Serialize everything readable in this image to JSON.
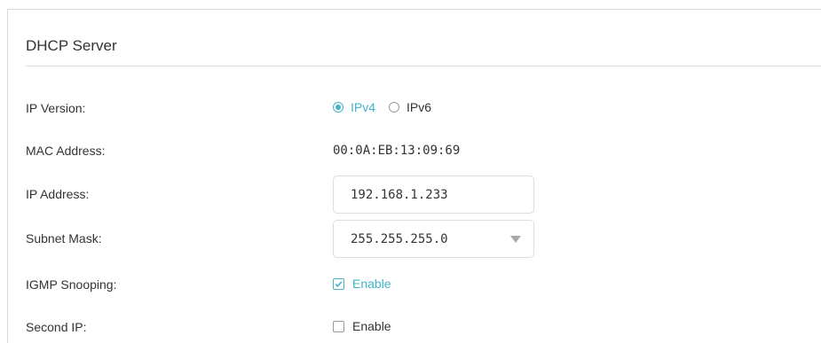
{
  "section": {
    "title": "DHCP Server"
  },
  "ip_version": {
    "label": "IP Version:",
    "options": [
      {
        "label": "IPv4",
        "selected": true
      },
      {
        "label": "IPv6",
        "selected": false
      }
    ]
  },
  "mac_address": {
    "label": "MAC Address:",
    "value": "00:0A:EB:13:09:69"
  },
  "ip_address": {
    "label": "IP Address:",
    "value": "192.168.1.233"
  },
  "subnet_mask": {
    "label": "Subnet Mask:",
    "value": "255.255.255.0"
  },
  "igmp_snooping": {
    "label": "IGMP Snooping:",
    "option_label": "Enable",
    "checked": true
  },
  "second_ip": {
    "label": "Second IP:",
    "option_label": "Enable",
    "checked": false
  },
  "colors": {
    "accent": "#42b4c8",
    "text": "#333333",
    "border": "#dddddd"
  }
}
